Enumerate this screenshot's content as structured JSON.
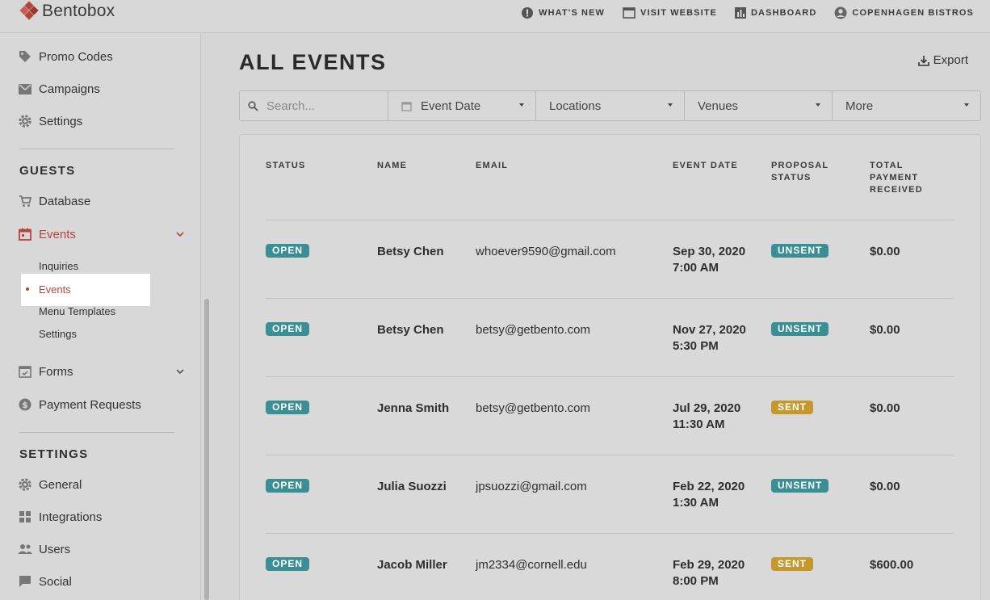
{
  "brand": {
    "name": "Bentobox"
  },
  "topnav": {
    "whats_new": "WHAT'S NEW",
    "visit_website": "VISIT WEBSITE",
    "dashboard": "DASHBOARD",
    "account": "COPENHAGEN BISTROS"
  },
  "sidebar": {
    "top_items": [
      {
        "label": "Promo Codes",
        "icon": "tag-icon"
      },
      {
        "label": "Campaigns",
        "icon": "mail-icon"
      },
      {
        "label": "Settings",
        "icon": "gear-icon"
      }
    ],
    "guests_heading": "GUESTS",
    "database": "Database",
    "events": "Events",
    "events_sub": [
      "Inquiries",
      "Events",
      "Menu Templates",
      "Settings"
    ],
    "forms": "Forms",
    "payment_requests": "Payment Requests",
    "settings_heading": "SETTINGS",
    "settings_items": [
      "General",
      "Integrations",
      "Users",
      "Social"
    ]
  },
  "main": {
    "title": "ALL EVENTS",
    "export": "Export",
    "filters": {
      "search_placeholder": "Search...",
      "event_date": "Event Date",
      "locations": "Locations",
      "venues": "Venues",
      "more": "More"
    },
    "columns": {
      "status": "STATUS",
      "name": "NAME",
      "email": "EMAIL",
      "event_date": "EVENT DATE",
      "proposal_status_1": "PROPOSAL",
      "proposal_status_2": "STATUS",
      "payment_1": "TOTAL",
      "payment_2": "PAYMENT",
      "payment_3": "RECEIVED"
    },
    "rows": [
      {
        "status": "OPEN",
        "name": "Betsy Chen",
        "email": "whoever9590@gmail.com",
        "date": "Sep 30, 2020",
        "time": "7:00 AM",
        "proposal": "UNSENT",
        "payment": "$0.00"
      },
      {
        "status": "OPEN",
        "name": "Betsy Chen",
        "email": "betsy@getbento.com",
        "date": "Nov 27, 2020",
        "time": "5:30 PM",
        "proposal": "UNSENT",
        "payment": "$0.00"
      },
      {
        "status": "OPEN",
        "name": "Jenna Smith",
        "email": "betsy@getbento.com",
        "date": "Jul 29, 2020",
        "time": "11:30 AM",
        "proposal": "SENT",
        "payment": "$0.00"
      },
      {
        "status": "OPEN",
        "name": "Julia Suozzi",
        "email": "jpsuozzi@gmail.com",
        "date": "Feb 22, 2020",
        "time": "1:30 AM",
        "proposal": "UNSENT",
        "payment": "$0.00"
      },
      {
        "status": "OPEN",
        "name": "Jacob Miller",
        "email": "jm2334@cornell.edu",
        "date": "Feb 29, 2020",
        "time": "8:00 PM",
        "proposal": "SENT",
        "payment": "$600.00"
      }
    ]
  },
  "colors": {
    "accent_red": "#b5443a",
    "teal": "#3a8f95",
    "gold": "#c6982c"
  }
}
